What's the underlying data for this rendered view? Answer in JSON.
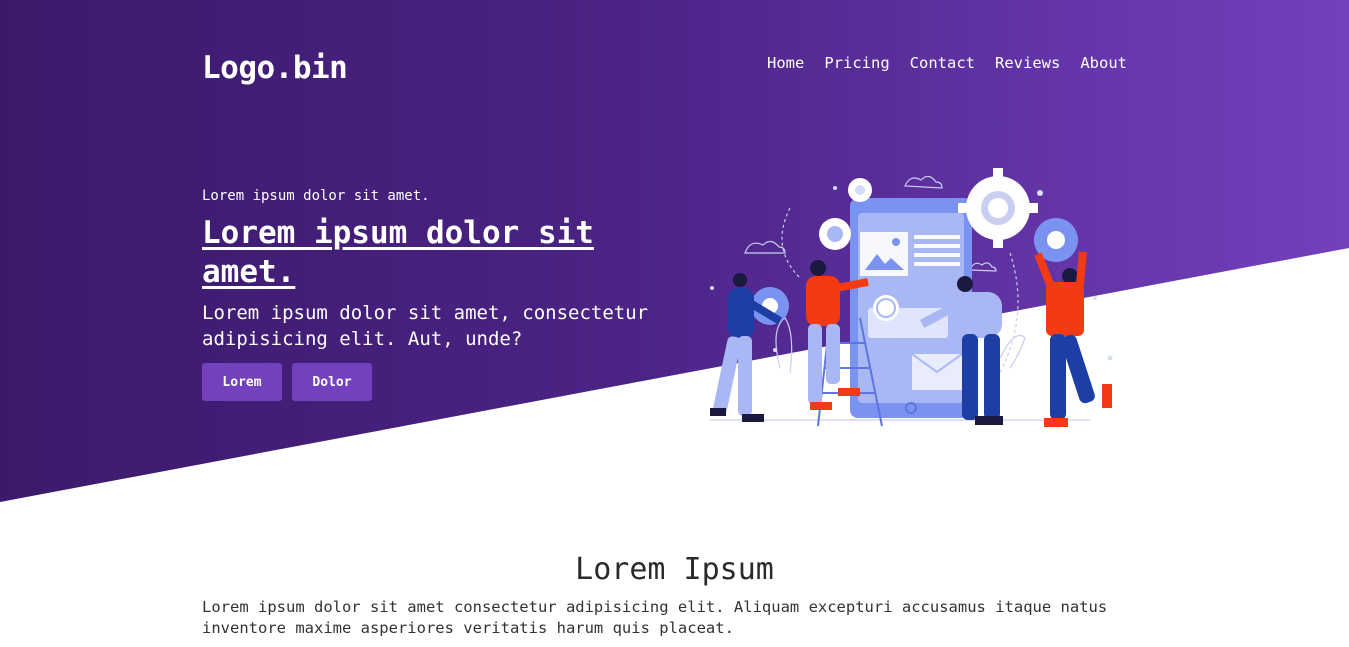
{
  "brand": {
    "logo_text": "Logo.bin"
  },
  "nav": {
    "links": [
      {
        "label": "Home"
      },
      {
        "label": "Pricing"
      },
      {
        "label": "Contact"
      },
      {
        "label": "Reviews"
      },
      {
        "label": "About"
      }
    ]
  },
  "hero": {
    "eyebrow": "Lorem ipsum dolor sit amet.",
    "title": "Lorem ipsum dolor sit amet.",
    "subtitle": "Lorem ipsum dolor sit amet, consectetur adipisicing elit. Aut, unde?",
    "buttons": [
      {
        "label": "Lorem"
      },
      {
        "label": "Dolor"
      }
    ],
    "illustration_icon": "team-gears-illustration"
  },
  "section": {
    "title": "Lorem Ipsum",
    "body": "Lorem ipsum dolor sit amet consectetur adipisicing elit. Aliquam excepturi accusamus itaque natus inventore maxime asperiores veritatis harum quis placeat."
  },
  "colors": {
    "hero_gradient_start": "#3b1a6b",
    "hero_gradient_end": "#7340be",
    "button_bg": "#7340be",
    "illustration_red": "#f23b14",
    "illustration_blue": "#7b93f0"
  }
}
